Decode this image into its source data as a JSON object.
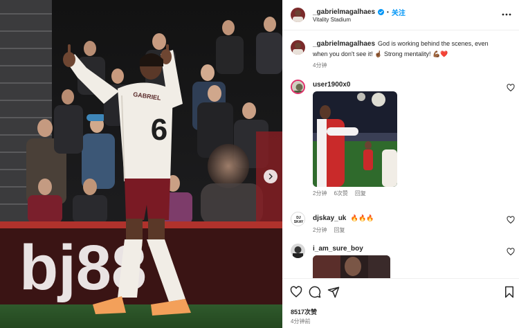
{
  "header": {
    "username": "_gabrielmagalhaes",
    "separator": "•",
    "follow_label": "关注",
    "location": "Vitality Stadium"
  },
  "photo": {
    "shirt_name": "GABRIEL",
    "shirt_number": "6",
    "ad_text": "bj88"
  },
  "caption": {
    "username": "_gabrielmagalhaes",
    "text": "God is working behind the scenes, even when you don't see it! ☝🏾 Strong mentality! 💪🏾❤️",
    "time": "4分钟"
  },
  "comments": [
    {
      "username": "user1900x0",
      "text": "",
      "time": "2分钟",
      "likes": "6次赞",
      "reply": "回复",
      "has_image": true
    },
    {
      "username": "djskay_uk",
      "text": "🔥🔥🔥",
      "time": "2分钟",
      "likes": "",
      "reply": "回复",
      "has_image": false,
      "avatar_text": "DJ SKAY"
    },
    {
      "username": "i_am_sure_boy",
      "text": "",
      "time": "",
      "likes": "",
      "reply": "",
      "has_image": true
    }
  ],
  "footer": {
    "likes": "8517次赞",
    "time_ago": "4分钟前"
  },
  "colors": {
    "accent": "#0095f6",
    "verified": "#0095f6",
    "kit_white": "#f1ede6",
    "kit_maroon": "#7a1a24"
  }
}
